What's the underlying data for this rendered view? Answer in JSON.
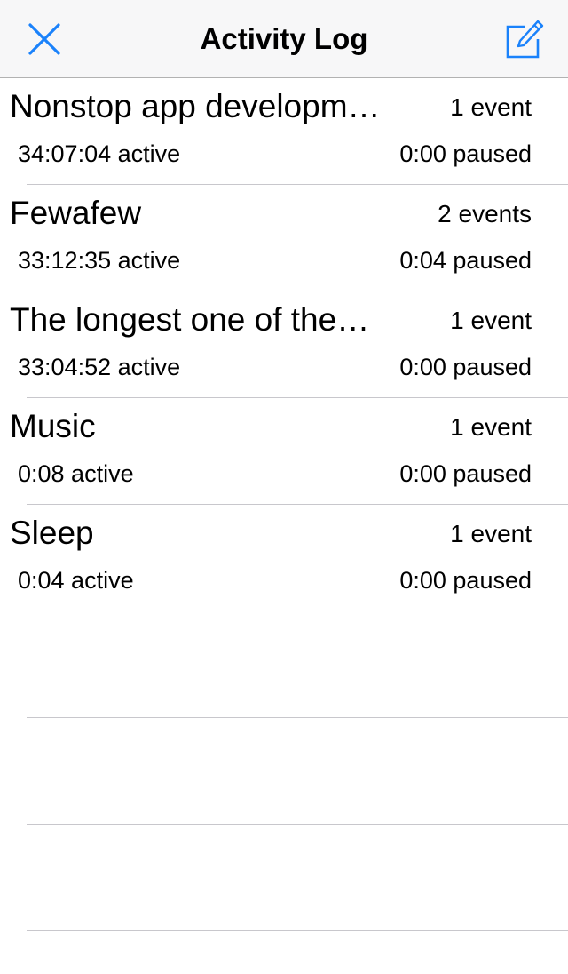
{
  "nav": {
    "title": "Activity Log",
    "close_icon": "close-x-icon",
    "compose_icon": "compose-icon",
    "accent_color": "#1a82fb"
  },
  "activities": [
    {
      "title": "Nonstop app development",
      "events": "1 event",
      "active": "34:07:04 active",
      "paused": "0:00 paused"
    },
    {
      "title": "Fewafew",
      "events": "2 events",
      "active": "33:12:35 active",
      "paused": "0:04 paused"
    },
    {
      "title": "The longest one of them all",
      "events": "1 event",
      "active": "33:04:52 active",
      "paused": "0:00 paused"
    },
    {
      "title": "Music",
      "events": "1 event",
      "active": "0:08 active",
      "paused": "0:00 paused"
    },
    {
      "title": "Sleep",
      "events": "1 event",
      "active": "0:04 active",
      "paused": "0:00 paused"
    }
  ]
}
